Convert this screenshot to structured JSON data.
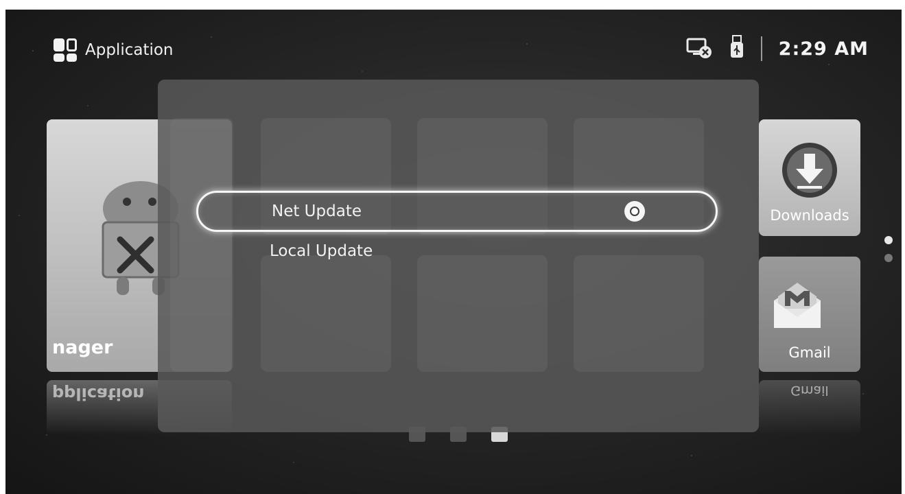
{
  "header": {
    "title": "Application",
    "time": "2:29 AM",
    "icons": [
      "apps-grid-icon",
      "network-disconnected-icon",
      "usb-icon"
    ]
  },
  "background_tiles": {
    "left_tile_label": "nager",
    "left_reflection_label": "pplication",
    "downloads_label": "Downloads",
    "gmail_label": "Gmail",
    "gmail_reflection_label": "Gmail"
  },
  "dialog": {
    "options": [
      {
        "label": "Net Update",
        "selected": true
      },
      {
        "label": "Local Update",
        "selected": false
      }
    ]
  },
  "pager": {
    "pages": 2,
    "current": 1
  },
  "colors": {
    "background": "#262626",
    "dialog": "#585858",
    "highlight": "#f6f6f6"
  }
}
